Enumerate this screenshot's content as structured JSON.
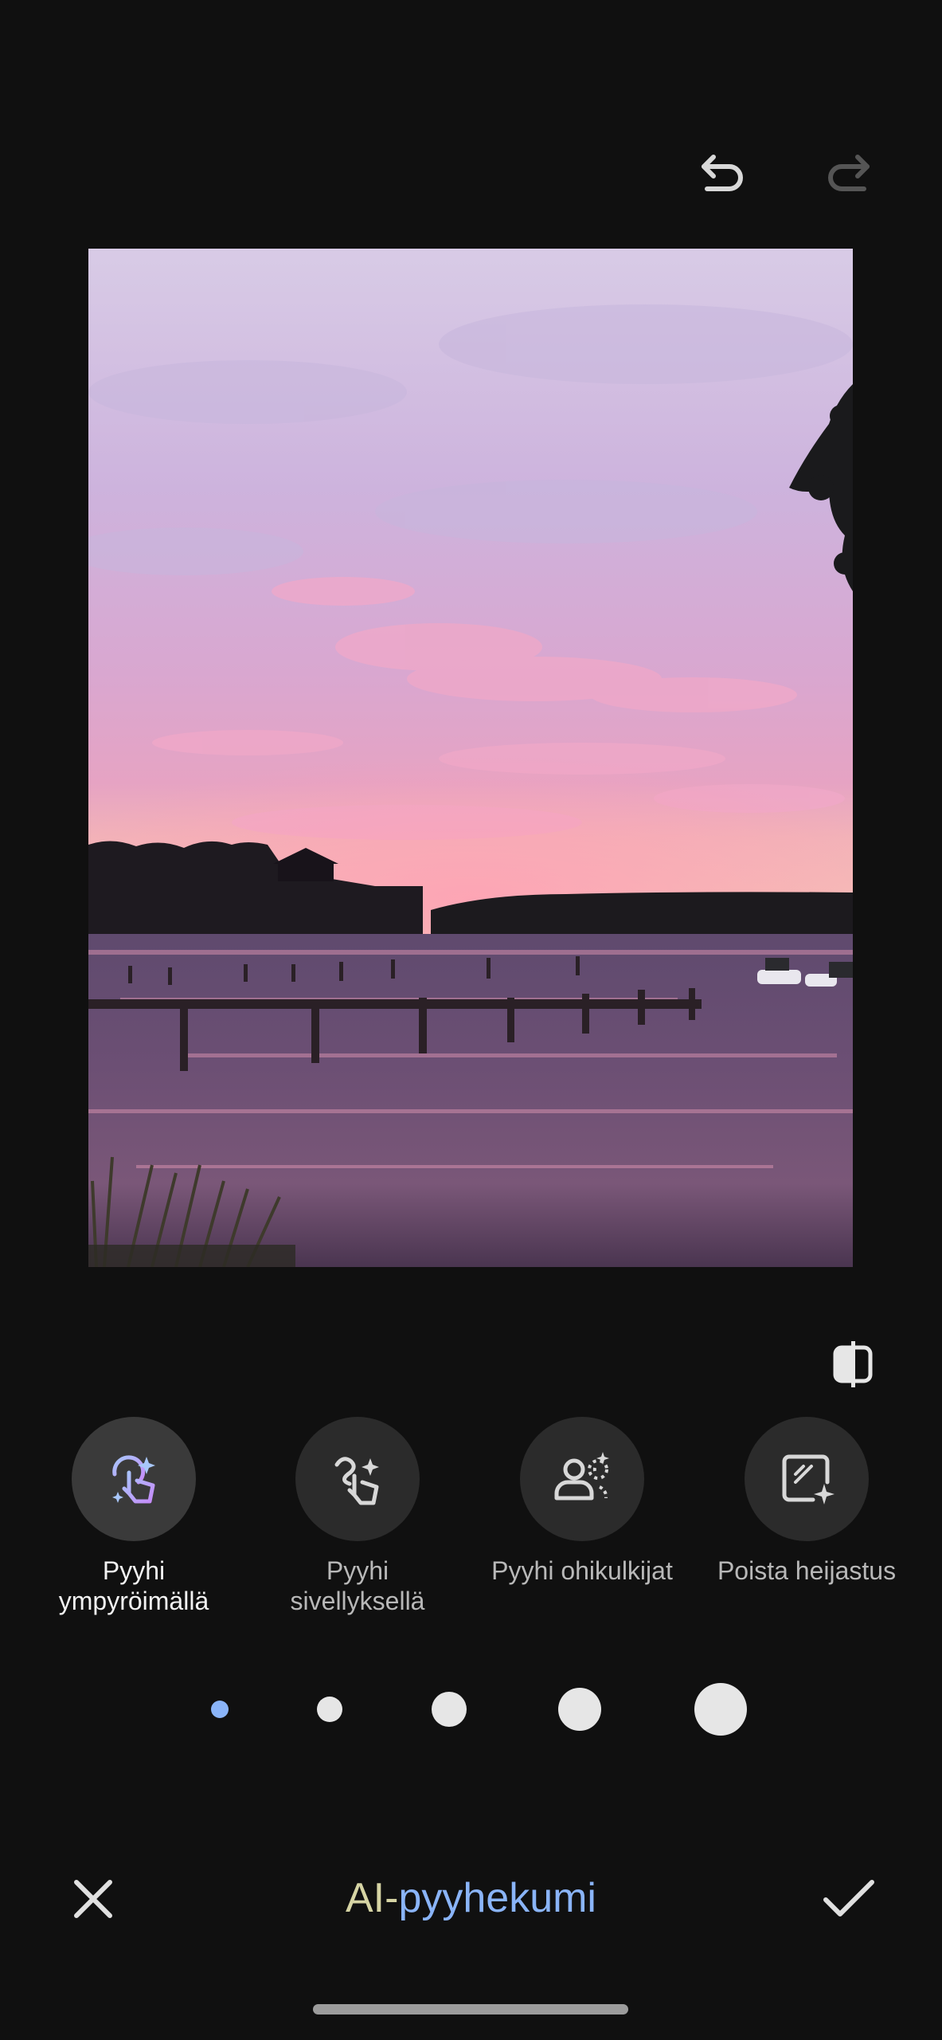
{
  "toolbar": {
    "undo_icon": "undo-icon",
    "redo_icon": "redo-icon"
  },
  "photo": {
    "subject": "lake-sunset-photo"
  },
  "compare_icon": "compare-icon",
  "tools": [
    {
      "label": "Pyyhi\nympyröimällä",
      "icon": "circle-to-erase-icon",
      "active": true
    },
    {
      "label": "Pyyhi\nsivellyksellä",
      "icon": "brush-erase-icon",
      "active": false
    },
    {
      "label": "Pyyhi ohikulkijat",
      "icon": "remove-people-icon",
      "active": false
    },
    {
      "label": "Poista heijastus",
      "icon": "remove-reflection-icon",
      "active": false
    }
  ],
  "brush_sizes": {
    "count": 5,
    "selected_index": 0,
    "selected_color": "#8ab4f8",
    "color": "#e6e6e6"
  },
  "bottom": {
    "title_ai": "AI-",
    "title_rest": "pyyhekumi",
    "cancel_icon": "close-icon",
    "confirm_icon": "check-icon"
  },
  "colors": {
    "background": "#101010",
    "accent_blue": "#8ab4f8",
    "accent_gold": "#d6d4a4"
  }
}
